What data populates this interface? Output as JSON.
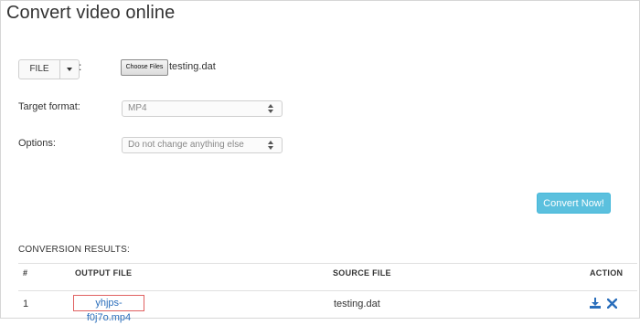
{
  "page": {
    "title": "Convert video online"
  },
  "file_picker": {
    "source_button_label": "FILE",
    "separator": ":",
    "choose_button_label": "Choose Files",
    "selected_file": "testing.dat"
  },
  "target_format": {
    "label": "Target format:",
    "value": "MP4"
  },
  "options": {
    "label": "Options:",
    "value": "Do not change anything else"
  },
  "convert_button": {
    "label": "Convert Now!",
    "color": "#5bc0de"
  },
  "results": {
    "title": "CONVERSION RESULTS:",
    "columns": [
      "#",
      "OUTPUT FILE",
      "SOURCE FILE",
      "ACTION"
    ],
    "rows": [
      {
        "index": "1",
        "output_file": "yhjps-f0j7o.mp4",
        "source_file": "testing.dat",
        "actions": [
          "download-icon",
          "delete-icon"
        ]
      }
    ]
  },
  "colors": {
    "link": "#2a6ebb",
    "icon": "#2a6ebb"
  }
}
